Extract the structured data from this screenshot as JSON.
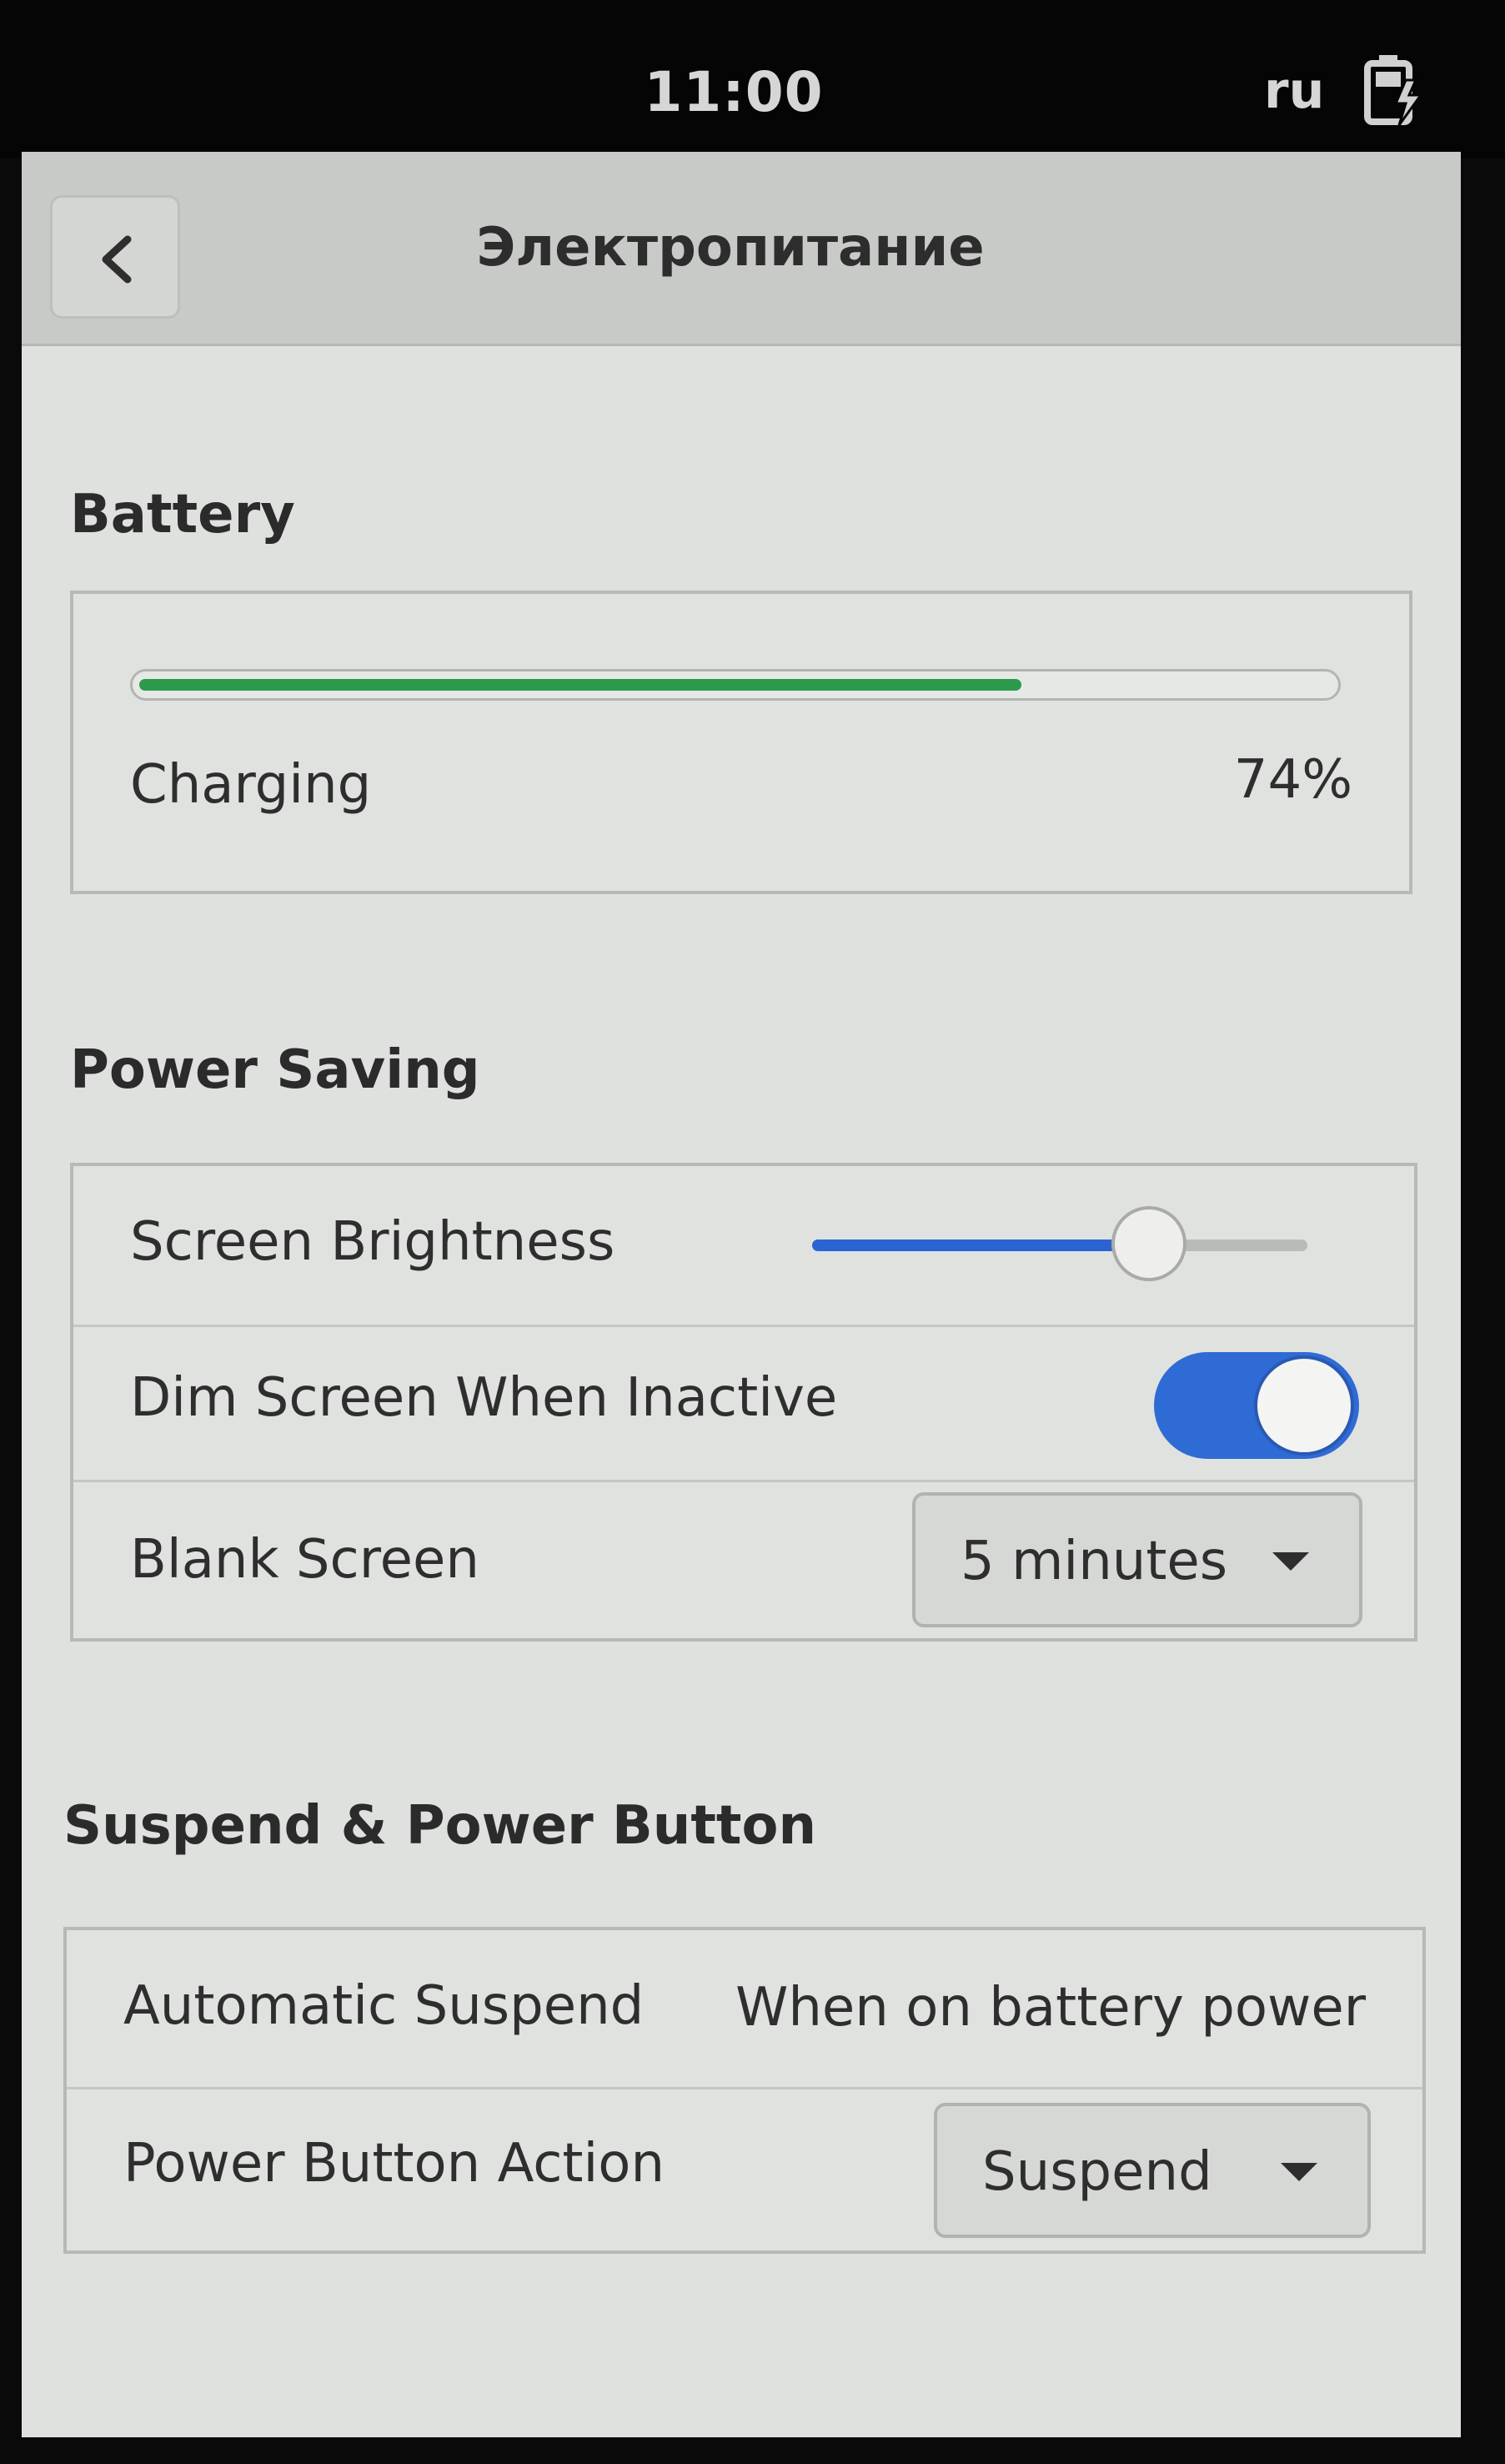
{
  "status_bar": {
    "time": "11:00",
    "language": "ru",
    "battery_icon": "battery-charging-icon"
  },
  "header": {
    "title": "Электропитание",
    "back_icon": "chevron-left-icon"
  },
  "battery": {
    "section_title": "Battery",
    "level_percent": 74,
    "level_label": "74%",
    "status": "Charging",
    "fill_color": "#2b9a4c"
  },
  "power_saving": {
    "section_title": "Power Saving",
    "brightness": {
      "label": "Screen Brightness",
      "value_fraction": 0.68
    },
    "dim_screen": {
      "label": "Dim Screen When Inactive",
      "enabled": true
    },
    "blank_screen": {
      "label": "Blank Screen",
      "selected": "5 minutes"
    },
    "accent_color": "#2f6bd4"
  },
  "suspend": {
    "section_title": "Suspend & Power Button",
    "automatic_suspend": {
      "label": "Automatic Suspend",
      "value": "When on battery power"
    },
    "power_button": {
      "label": "Power Button Action",
      "selected": "Suspend"
    }
  }
}
